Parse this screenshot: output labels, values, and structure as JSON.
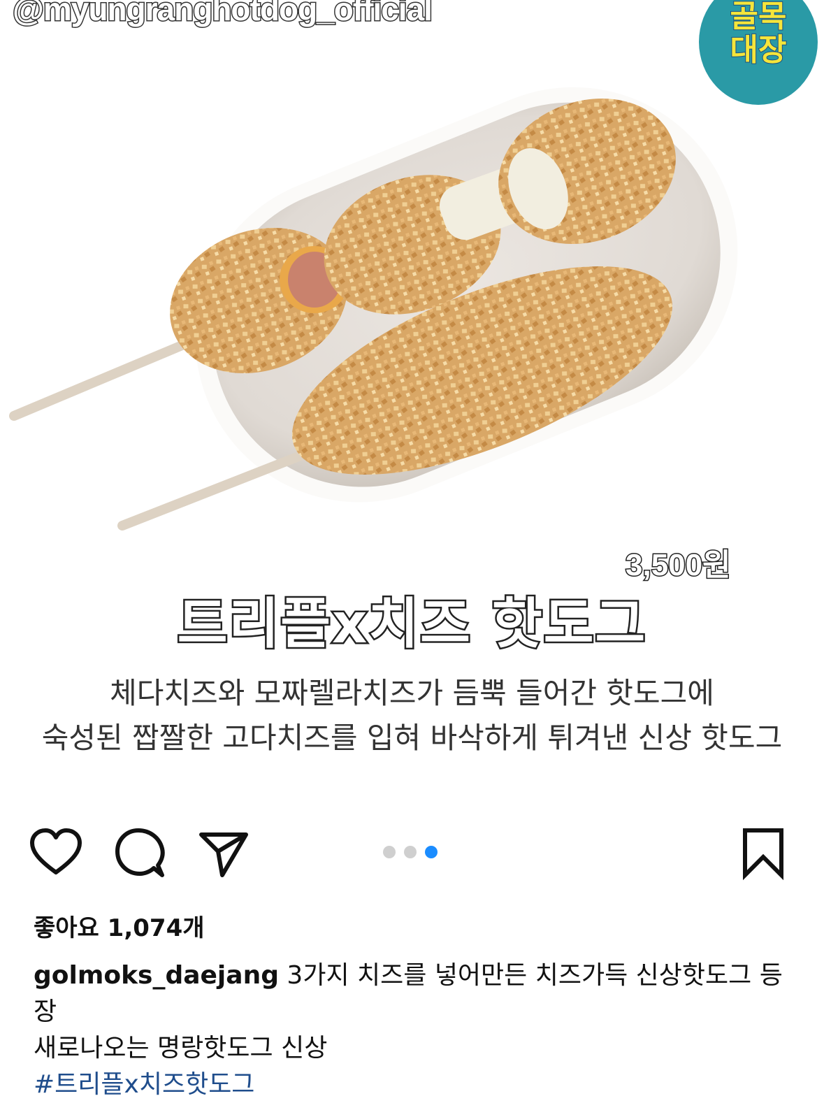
{
  "post": {
    "watermark": "@myungranghotdog_official",
    "badge": {
      "line1": "골목",
      "line2": "대장",
      "color": "#2a9aa6"
    },
    "price": "3,500원",
    "product_title": "트리플x치즈 핫도그",
    "description": [
      "체다치즈와 모짜렐라치즈가 듬뿍 들어간 핫도그에",
      "숙성된 짭짤한 고다치즈를 입혀 바삭하게 튀겨낸 신상 핫도그"
    ]
  },
  "actions": {
    "icons": [
      "heart-icon",
      "comment-icon",
      "share-icon",
      "bookmark-icon"
    ],
    "carousel": {
      "count": 3,
      "active_index": 3,
      "active_color": "#1a8cff"
    }
  },
  "likes": {
    "label": "좋아요 1,074개"
  },
  "caption": {
    "username": "golmoks_daejang",
    "text": "3가지 치즈를 넣어만든 치즈가득 신상핫도그 등장",
    "line2": "새로나오는 명랑핫도그 신상",
    "hashtag": "#트리플x치즈핫도그"
  }
}
